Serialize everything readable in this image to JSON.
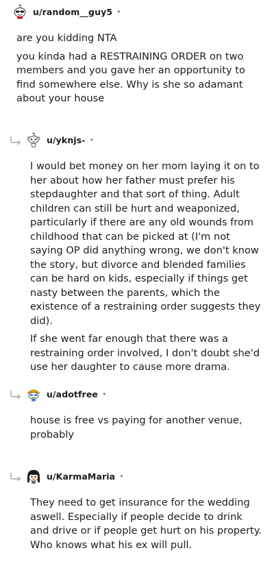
{
  "comments": [
    {
      "username": "u/random__guy5",
      "separator": "•",
      "avatar_icon": "snoo-sunglasses-avatar-icon",
      "paragraphs": [
        "are you kidding NTA",
        "you kinda had a RESTRAINING ORDER on two members and you gave her an opportunity to find somewhere else. Why is she so adamant about your house"
      ]
    },
    {
      "username": "u/yknjs-",
      "separator": "•",
      "avatar_icon": "snoo-default-avatar-icon",
      "paragraphs": [
        "I would bet money on her mom laying it on to her about how her father must prefer his stepdaughter and that sort of thing. Adult children can still be hurt and weaponized, particularly if there are any old wounds from childhood that can be picked at (I'm not saying OP did anything wrong, we don't know the story, but divorce and blended families can be hard on kids, especially if things get nasty between the parents, which the existence of a restraining order suggests they did).",
        "If she went far enough that there was a restraining order involved, I don't doubt she'd use her daughter to cause more drama."
      ]
    },
    {
      "username": "u/adotfree",
      "separator": "•",
      "avatar_icon": "snoo-hardhat-avatar-icon",
      "paragraphs": [
        "house is free vs paying for another venue, probably"
      ]
    },
    {
      "username": "u/KarmaMaria",
      "separator": "•",
      "avatar_icon": "snoo-dark-hair-avatar-icon",
      "paragraphs": [
        "They need to get insurance for the wedding aswell. Especially if people decide to drink and drive or if people get hurt on his property. Who knows what his ex will pull."
      ]
    }
  ]
}
